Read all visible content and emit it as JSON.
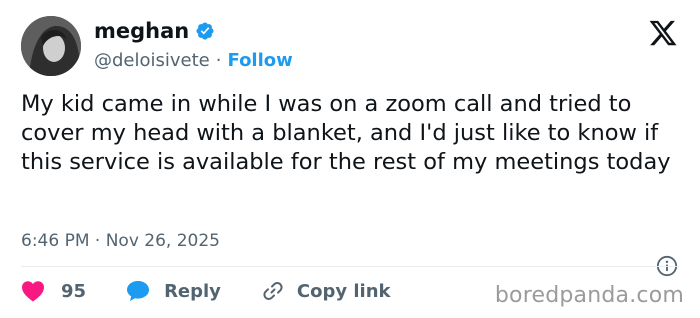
{
  "author": {
    "name": "meghan",
    "handle": "@deloisivete",
    "follow_label": "Follow",
    "separator": "·"
  },
  "tweet": {
    "text": "My kid came in while I was on a zoom call and tried to cover my head with a blanket, and I'd just like to know if this service is available for the rest of my meetings today",
    "timestamp": "6:46 PM · Nov 26, 2025"
  },
  "actions": {
    "likes": "95",
    "reply_label": "Reply",
    "copy_link_label": "Copy link"
  },
  "watermark": "boredpanda.com",
  "icons": {
    "verified": "verified-badge-icon",
    "platform": "x-logo-icon",
    "info": "info-icon",
    "like": "heart-icon",
    "reply": "speech-bubble-icon",
    "link": "link-icon"
  },
  "colors": {
    "accent": "#1d9bf0",
    "like": "#f91880",
    "text": "#0f1419",
    "muted": "#536471"
  }
}
